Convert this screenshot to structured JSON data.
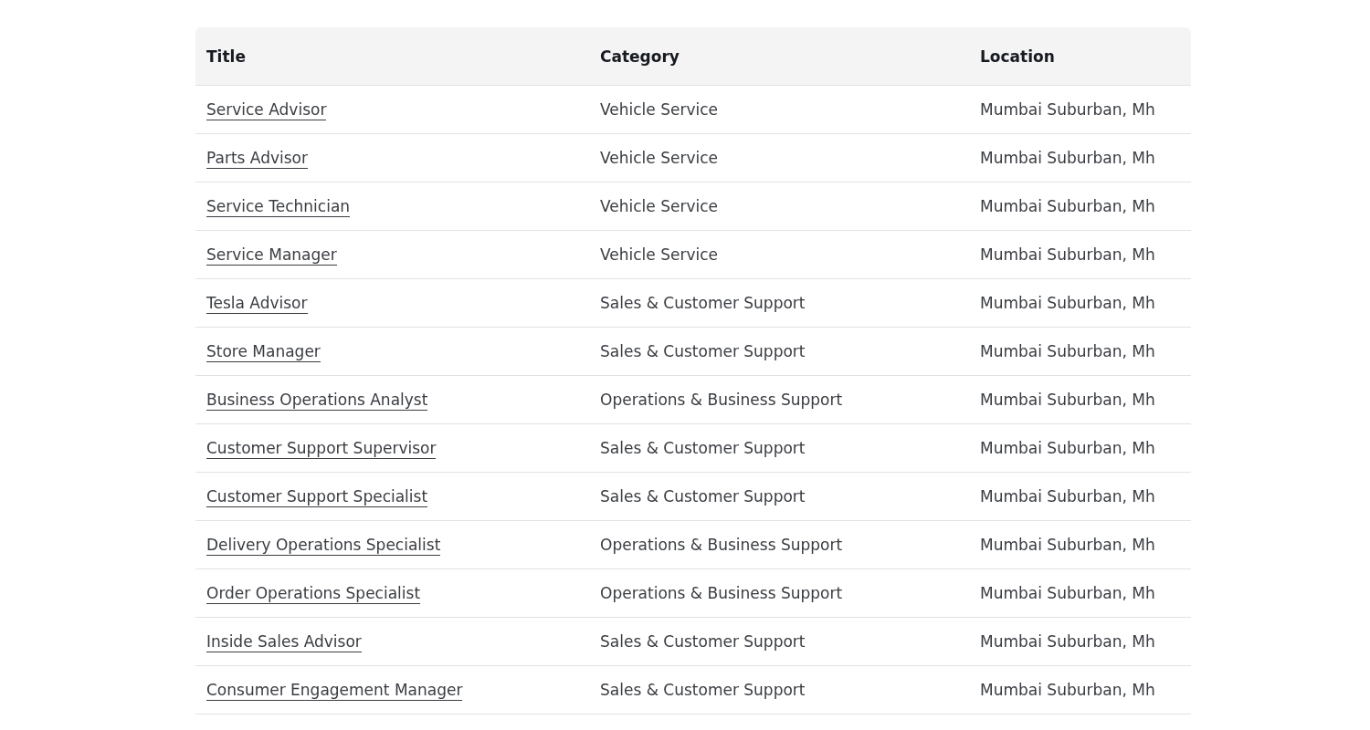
{
  "table": {
    "columns": [
      "Title",
      "Category",
      "Location"
    ],
    "rows": [
      {
        "title": "Service Advisor",
        "category": "Vehicle Service",
        "location": "Mumbai Suburban, Mh"
      },
      {
        "title": "Parts Advisor",
        "category": "Vehicle Service",
        "location": "Mumbai Suburban, Mh"
      },
      {
        "title": "Service Technician",
        "category": "Vehicle Service",
        "location": "Mumbai Suburban, Mh"
      },
      {
        "title": "Service Manager",
        "category": "Vehicle Service",
        "location": "Mumbai Suburban, Mh"
      },
      {
        "title": "Tesla Advisor",
        "category": "Sales & Customer Support",
        "location": "Mumbai Suburban, Mh"
      },
      {
        "title": "Store Manager",
        "category": "Sales & Customer Support",
        "location": "Mumbai Suburban, Mh"
      },
      {
        "title": "Business Operations Analyst",
        "category": "Operations & Business Support",
        "location": "Mumbai Suburban, Mh"
      },
      {
        "title": "Customer Support Supervisor",
        "category": "Sales & Customer Support",
        "location": "Mumbai Suburban, Mh"
      },
      {
        "title": "Customer Support Specialist",
        "category": "Sales & Customer Support",
        "location": "Mumbai Suburban, Mh"
      },
      {
        "title": "Delivery Operations Specialist",
        "category": "Operations & Business Support",
        "location": "Mumbai Suburban, Mh"
      },
      {
        "title": "Order Operations Specialist",
        "category": "Operations & Business Support",
        "location": "Mumbai Suburban, Mh"
      },
      {
        "title": "Inside Sales Advisor",
        "category": "Sales & Customer Support",
        "location": "Mumbai Suburban, Mh"
      },
      {
        "title": "Consumer Engagement Manager",
        "category": "Sales & Customer Support",
        "location": "Mumbai Suburban, Mh"
      }
    ]
  }
}
